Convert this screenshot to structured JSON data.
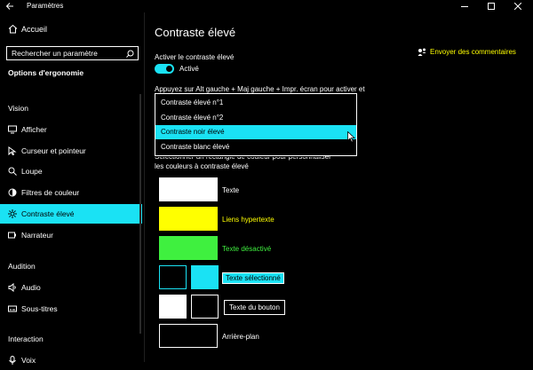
{
  "window": {
    "title": "Paramètres"
  },
  "sidebar": {
    "home": "Accueil",
    "search_placeholder": "Rechercher un paramètre",
    "section_title": "Options d'ergonomie",
    "groups": {
      "vision": "Vision",
      "audition": "Audition",
      "interaction": "Interaction"
    },
    "items": [
      {
        "label": "Afficher",
        "icon": "display-icon"
      },
      {
        "label": "Curseur et pointeur",
        "icon": "pointer-icon"
      },
      {
        "label": "Loupe",
        "icon": "magnifier-icon"
      },
      {
        "label": "Filtres de couleur",
        "icon": "color-filter-icon"
      },
      {
        "label": "Contraste élevé",
        "icon": "sun-icon",
        "active": true
      },
      {
        "label": "Narrateur",
        "icon": "narrator-icon"
      },
      {
        "label": "Audio",
        "icon": "speaker-icon"
      },
      {
        "label": "Sous-titres",
        "icon": "captions-icon"
      },
      {
        "label": "Voix",
        "icon": "microphone-icon"
      }
    ]
  },
  "main": {
    "title": "Contraste élevé",
    "feedback_link": "Envoyer des commentaires",
    "toggle_heading": "Activer le contraste élevé",
    "toggle_state": "Activé",
    "toggle_on": true,
    "shortcut_text": "Appuyez sur Alt gauche + Maj gauche + Impr. écran pour activer et",
    "theme_options": [
      "Contraste élevé n°1",
      "Contraste élevé n°2",
      "Contraste noir élevé",
      "Contraste blanc élevé"
    ],
    "selected_theme": "Contraste noir élevé",
    "color_instruction": "Sélectionner un rectangle de couleur pour personnaliser les couleurs à contraste élevé",
    "color_items": {
      "text": "Texte",
      "hyperlinks": "Liens hypertexte",
      "disabled": "Texte désactivé",
      "selected": "Texte sélectionné",
      "button": "Texte du bouton",
      "background": "Arrière-plan"
    }
  },
  "colors": {
    "accent": "#1ae2f4",
    "hyperlink": "#ffff00",
    "disabled": "#3ff03f",
    "text": "#ffffff",
    "background": "#000000"
  }
}
